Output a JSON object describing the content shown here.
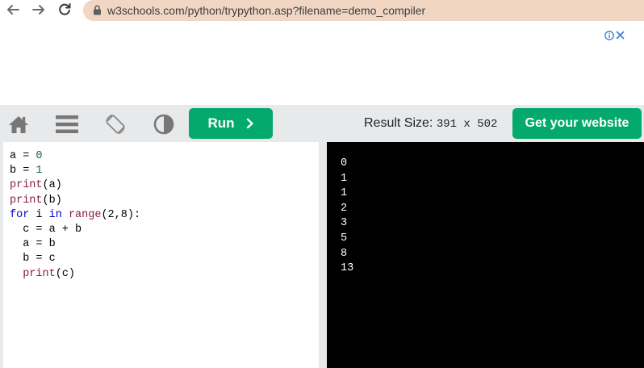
{
  "browser": {
    "url": "w3schools.com/python/trypython.asp?filename=demo_compiler"
  },
  "toolbar": {
    "run_label": "Run",
    "result_size_label": "Result Size:",
    "result_size_value": "391 x 502",
    "website_label": "Get your website"
  },
  "code_lines": [
    [
      {
        "t": "a = ",
        "c": ""
      },
      {
        "t": "0",
        "c": "num"
      }
    ],
    [
      {
        "t": "b = ",
        "c": ""
      },
      {
        "t": "1",
        "c": "num"
      }
    ],
    [
      {
        "t": "print",
        "c": "fn"
      },
      {
        "t": "(a)",
        "c": ""
      }
    ],
    [
      {
        "t": "print",
        "c": "fn"
      },
      {
        "t": "(b)",
        "c": ""
      }
    ],
    [
      {
        "t": "for",
        "c": "kw"
      },
      {
        "t": " i ",
        "c": ""
      },
      {
        "t": "in",
        "c": "kw"
      },
      {
        "t": " ",
        "c": ""
      },
      {
        "t": "range",
        "c": "fn"
      },
      {
        "t": "(2,8):",
        "c": ""
      }
    ],
    [
      {
        "t": "  c = a + b",
        "c": ""
      }
    ],
    [
      {
        "t": "  a = b",
        "c": ""
      }
    ],
    [
      {
        "t": "  b = c",
        "c": ""
      }
    ],
    [
      {
        "t": "  ",
        "c": ""
      },
      {
        "t": "print",
        "c": "fn"
      },
      {
        "t": "(c)",
        "c": ""
      }
    ]
  ],
  "output_lines": [
    "0",
    "1",
    "1",
    "2",
    "3",
    "5",
    "8",
    "13"
  ],
  "colors": {
    "accent_green": "#04aa6d",
    "toolbar_bg": "#e7e9eb",
    "url_bar_bg": "#f2d6c4",
    "result_bg": "#000000"
  },
  "icons": {
    "back": "arrow-left-icon",
    "forward": "arrow-right-icon",
    "reload": "reload-icon",
    "lock": "lock-icon",
    "ad_info": "info-icon",
    "ad_close": "close-icon",
    "home": "home-icon",
    "menu": "menu-icon",
    "rotate": "rotate-orientation-icon",
    "contrast": "contrast-icon",
    "run_chevron": "chevron-right-icon"
  }
}
